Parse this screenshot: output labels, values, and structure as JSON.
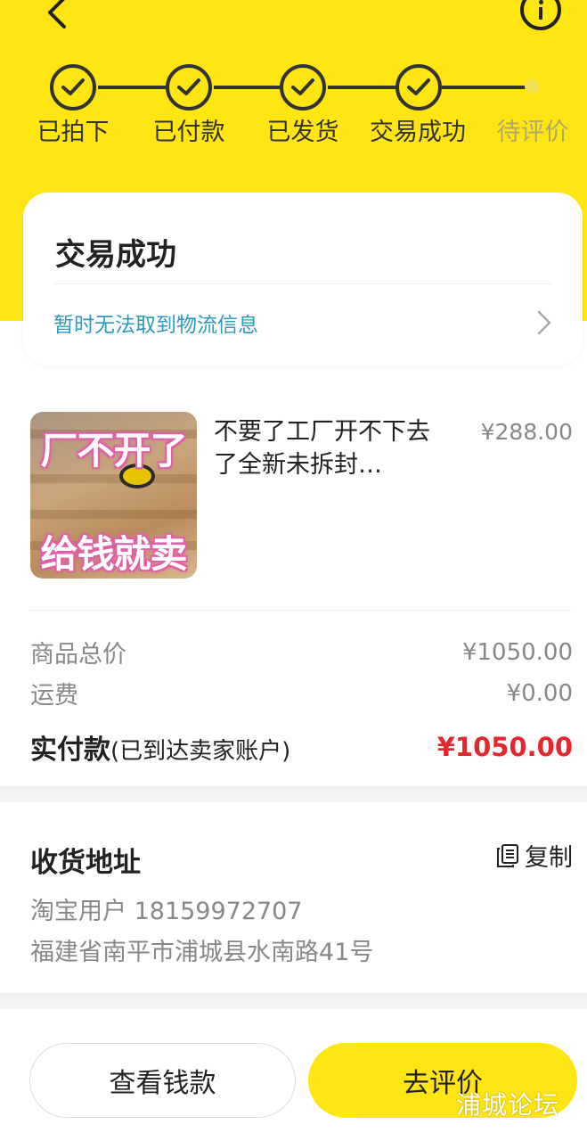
{
  "steps": [
    {
      "label": "已拍下",
      "done": true
    },
    {
      "label": "已付款",
      "done": true
    },
    {
      "label": "已发货",
      "done": true
    },
    {
      "label": "交易成功",
      "done": true
    },
    {
      "label": "待评价",
      "done": false
    }
  ],
  "status": {
    "title": "交易成功",
    "logistics": "暂时无法取到物流信息"
  },
  "product": {
    "image_text_top": "厂不开了",
    "image_text_bottom": "给钱就卖",
    "title": "不要了工厂开不下去了全新未拆封…",
    "price": "¥288.00"
  },
  "fees": {
    "total_label": "商品总价",
    "total_value": "¥1050.00",
    "shipping_label": "运费",
    "shipping_value": "¥0.00",
    "paid_label": "实付款",
    "paid_note": "(已到达卖家账户)",
    "paid_value": "¥1050.00"
  },
  "address": {
    "title": "收货地址",
    "copy_label": "复制",
    "name_phone": "淘宝用户 18159972707",
    "detail": "福建省南平市浦城县水南路41号"
  },
  "actions": {
    "view_money": "查看钱款",
    "review": "去评价"
  },
  "watermark": "浦城论坛",
  "colors": {
    "brand_yellow": "#ffe512",
    "paid_red": "#e0282e",
    "link_blue": "#2a9bbf"
  }
}
